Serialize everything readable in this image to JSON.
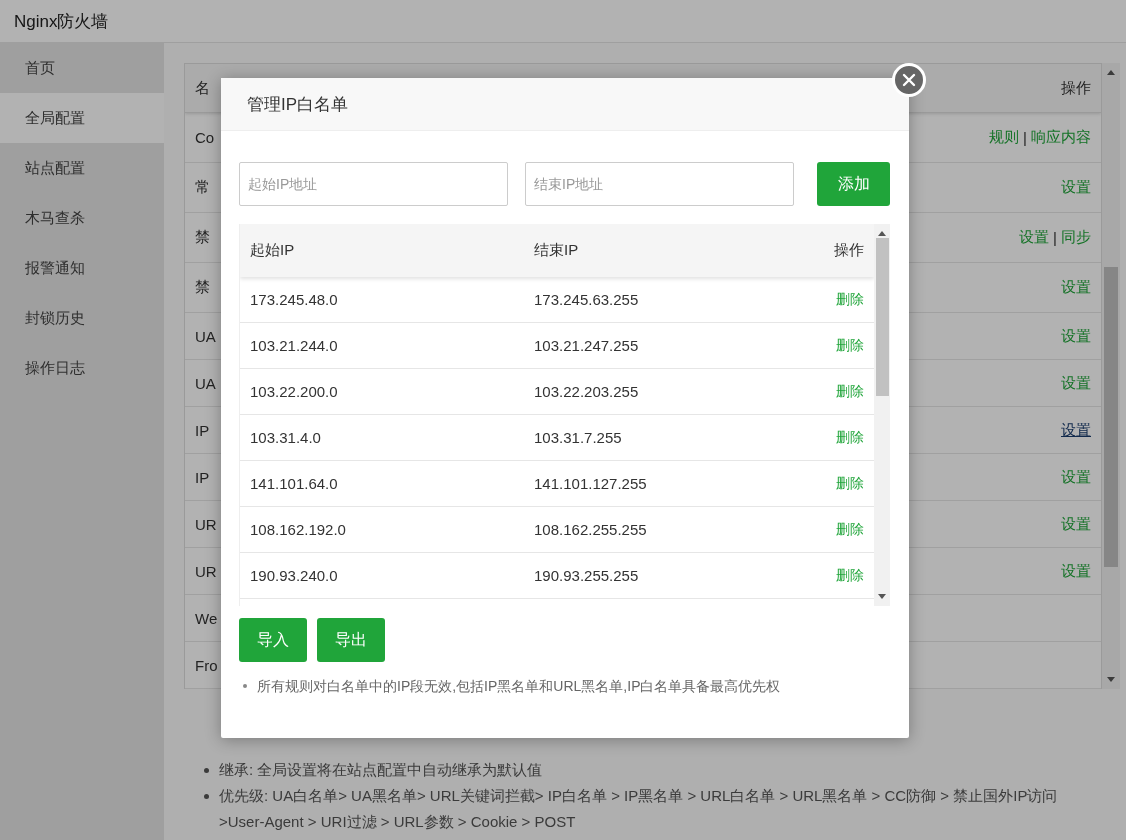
{
  "window": {
    "title": "Nginx防火墙"
  },
  "sidebar": {
    "items": [
      {
        "label": "首页",
        "selected": false
      },
      {
        "label": "全局配置",
        "selected": true
      },
      {
        "label": "站点配置",
        "selected": false
      },
      {
        "label": "木马查杀",
        "selected": false
      },
      {
        "label": "报警通知",
        "selected": false
      },
      {
        "label": "封锁历史",
        "selected": false
      },
      {
        "label": "操作日志",
        "selected": false
      }
    ]
  },
  "table": {
    "columns": [
      "名",
      "操作"
    ],
    "separator": "|",
    "rows": [
      {
        "name": "Co",
        "actions": [
          {
            "label": "规则",
            "hovered": false
          },
          {
            "label": "响应内容",
            "hovered": false
          }
        ]
      },
      {
        "name": "常",
        "actions": [
          {
            "label": "设置",
            "hovered": false
          }
        ]
      },
      {
        "name": "禁",
        "actions": [
          {
            "label": "设置",
            "hovered": false
          },
          {
            "label": "同步",
            "hovered": false
          }
        ]
      },
      {
        "name": "禁",
        "actions": [
          {
            "label": "设置",
            "hovered": false
          }
        ]
      },
      {
        "name": "UA",
        "actions": [
          {
            "label": "设置",
            "hovered": false
          }
        ]
      },
      {
        "name": "UA",
        "actions": [
          {
            "label": "设置",
            "hovered": false
          }
        ]
      },
      {
        "name": "IP",
        "actions": [
          {
            "label": "设置",
            "hovered": true
          }
        ]
      },
      {
        "name": "IP",
        "actions": [
          {
            "label": "设置",
            "hovered": false
          }
        ]
      },
      {
        "name": "UR",
        "actions": [
          {
            "label": "设置",
            "hovered": false
          }
        ]
      },
      {
        "name": "UR",
        "actions": [
          {
            "label": "设置",
            "hovered": false
          }
        ]
      },
      {
        "name": "We",
        "actions": []
      },
      {
        "name": "Fro",
        "actions": []
      }
    ]
  },
  "notes": [
    "继承: 全局设置将在站点配置中自动继承为默认值",
    "优先级: UA白名单> UA黑名单> URL关键词拦截> IP白名单 > IP黑名单 > URL白名单 > URL黑名单 > CC防御 > 禁止国外IP访问 >User-Agent > URI过滤 > URL参数 > Cookie > POST"
  ],
  "dialog": {
    "title": "管理IP白名单",
    "start_field": {
      "placeholder": "起始IP地址"
    },
    "end_field": {
      "placeholder": "结束IP地址"
    },
    "add_button": "添加",
    "columns": [
      "起始IP",
      "结束IP",
      "操作"
    ],
    "rows": [
      {
        "start": "173.245.48.0",
        "end": "173.245.63.255",
        "action": "删除"
      },
      {
        "start": "103.21.244.0",
        "end": "103.21.247.255",
        "action": "删除"
      },
      {
        "start": "103.22.200.0",
        "end": "103.22.203.255",
        "action": "删除"
      },
      {
        "start": "103.31.4.0",
        "end": "103.31.7.255",
        "action": "删除"
      },
      {
        "start": "141.101.64.0",
        "end": "141.101.127.255",
        "action": "删除"
      },
      {
        "start": "108.162.192.0",
        "end": "108.162.255.255",
        "action": "删除"
      },
      {
        "start": "190.93.240.0",
        "end": "190.93.255.255",
        "action": "删除"
      }
    ],
    "buttons": [
      "导入",
      "导出"
    ],
    "note": "所有规则对白名单中的IP段无效,包括IP黑名单和URL黑名单,IP白名单具备最高优先权"
  }
}
